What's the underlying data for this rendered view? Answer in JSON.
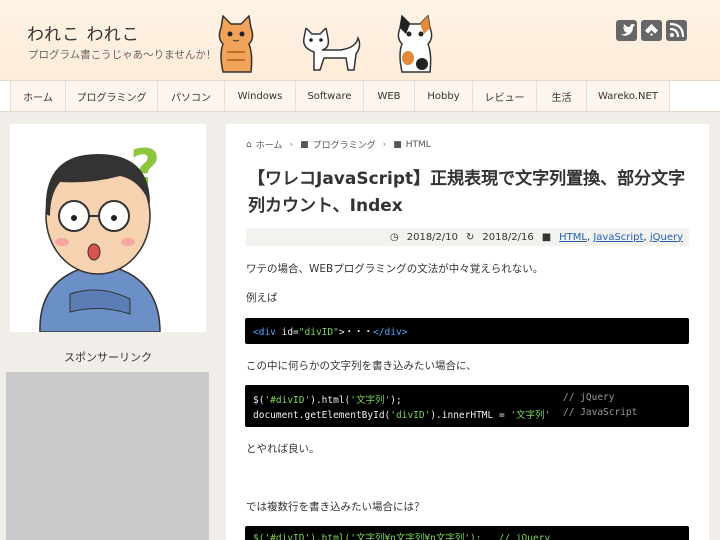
{
  "header": {
    "site_title": "われこ われこ",
    "site_desc": "プログラム書こうじゃあ～りませんか！",
    "social_icons": [
      "twitter-icon",
      "feedly-icon",
      "rss-icon"
    ]
  },
  "nav": {
    "items": [
      "ホーム",
      "プログラミング",
      "パソコン",
      "Windows",
      "Software",
      "WEB",
      "Hobby",
      "レビュー",
      "生活",
      "Wareko.NET"
    ]
  },
  "sidebar": {
    "sponsor_label": "スポンサーリンク"
  },
  "breadcrumb": {
    "home": "ホーム",
    "cat1": "プログラミング",
    "cat2": "HTML"
  },
  "post": {
    "title": "【ワレコJavaScript】正規表現で文字列置換、部分文字列カウント、Index",
    "date_published": "2018/2/10",
    "date_updated": "2018/2/16",
    "categories": [
      "HTML",
      "jQuery"
    ],
    "tag_first": "HTML",
    "para1": "ワテの場合、WEBプログラミングの文法が中々覚えられない。",
    "para2": "例えば",
    "code1": {
      "open_tag": "<div",
      "attr": " id=",
      "value": "\"divID\"",
      "middle": ">・・・",
      "close_tag": "</div>"
    },
    "para3": "この中に何らかの文字列を書き込みたい場合に、",
    "code2": {
      "l1_prefix": "$(",
      "l1_sel": "'#divID'",
      "l1_mid": ").html(",
      "l1_str": "'文字列'",
      "l1_end": ");",
      "l1_comment": "// jQuery",
      "l2_prefix": "document.getElementById(",
      "l2_sel": "'divID'",
      "l2_mid": ").innerHTML = ",
      "l2_str": "'文字列'",
      "l2_comment": "// JavaScript"
    },
    "para4": "とやれば良い。",
    "para5": "では複数行を書き込みたい場合には？",
    "code3_partial": "$('#divID').html('文字列¥n文字列¥n文字列');   // jQuery"
  },
  "colors": {
    "header_bg": "#fff3e6",
    "link": "#1f5fb8",
    "code_bg": "#000000",
    "code_tag": "#4aa7ff",
    "code_string": "#7cd65a"
  }
}
